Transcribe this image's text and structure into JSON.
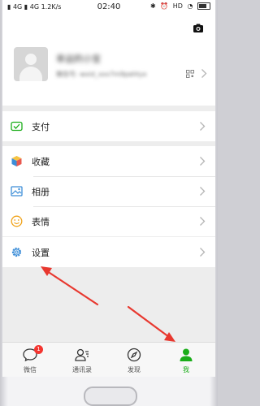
{
  "status_bar": {
    "left": " 4G   4G   1.2K/s",
    "left_sim1": "4G",
    "left_sim2": "4G",
    "speed": "1.2K/s",
    "time": "02:40",
    "hd": "HD",
    "battery_icon": "battery-icon"
  },
  "profile": {
    "nickname": "幸运的小宝",
    "wechat_id": "微信号: wxid_xxx7m9pehtyx"
  },
  "menu": {
    "group1": [
      {
        "label": "支付",
        "icon": "payment-icon",
        "color": "#1aad19"
      }
    ],
    "group2": [
      {
        "label": "收藏",
        "icon": "favorites-cube-icon",
        "color": "#f0a31a"
      },
      {
        "label": "相册",
        "icon": "album-icon",
        "color": "#3d8ed8"
      },
      {
        "label": "表情",
        "icon": "sticker-smile-icon",
        "color": "#f0a31a"
      }
    ],
    "group3": [
      {
        "label": "设置",
        "icon": "settings-gear-icon",
        "color": "#3d8ed8"
      }
    ]
  },
  "tabbar": {
    "tabs": [
      {
        "label": "微信",
        "icon": "chat-bubble-icon",
        "badge": "1"
      },
      {
        "label": "通讯录",
        "icon": "contacts-icon"
      },
      {
        "label": "发现",
        "icon": "compass-icon"
      },
      {
        "label": "我",
        "icon": "me-person-icon",
        "active": true
      }
    ]
  },
  "colors": {
    "accent_green": "#1aad19",
    "arrow_red": "#e8382f",
    "badge_red": "#f43530"
  }
}
